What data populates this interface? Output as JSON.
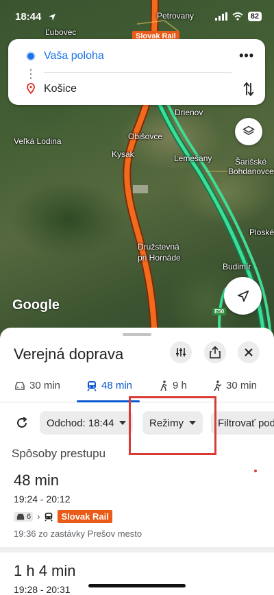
{
  "status_bar": {
    "time": "18:44",
    "battery": "82"
  },
  "map": {
    "rail_label": "Slovak Rail",
    "places": [
      "Ľubovec",
      "Petrovany",
      "Drienov",
      "Veľká Lodina",
      "Obišovce",
      "Kysak",
      "Lemešany",
      "Šarišské",
      "Bohdanovce",
      "Ploské",
      "Družstevná",
      "pri Hornáde",
      "Budimír"
    ],
    "attribution": "Google",
    "road_shield": "E50"
  },
  "directions_card": {
    "origin": "Vaša poloha",
    "destination": "Košice",
    "more_icon": "more-horiz-icon",
    "swap_icon": "swap-vert-icon"
  },
  "sheet": {
    "title": "Verejná doprava",
    "tabs": [
      {
        "icon": "car-icon",
        "label": "30 min"
      },
      {
        "icon": "transit-icon",
        "label": "48 min"
      },
      {
        "icon": "walk-icon",
        "label": "9 h"
      },
      {
        "icon": "ride-icon",
        "label": "30 min"
      }
    ],
    "chips": {
      "departure": "Odchod: 18:44",
      "modes": "Režimy",
      "filter": "Filtrovať podľa"
    },
    "section_title": "Spôsoby prestupu",
    "routes": [
      {
        "duration": "48 min",
        "times": "19:24 - 20:12",
        "car_minutes": "6",
        "rail": "Slovak Rail",
        "departure_info": "19:36 zo zastávky Prešov mesto"
      },
      {
        "duration": "1 h 4 min",
        "times": "19:28 - 20:31"
      }
    ]
  },
  "colors": {
    "accent": "#0b57d0",
    "rail": "#ea5b19",
    "route_green": "#3ddc97",
    "highlight": "#d93b34"
  }
}
